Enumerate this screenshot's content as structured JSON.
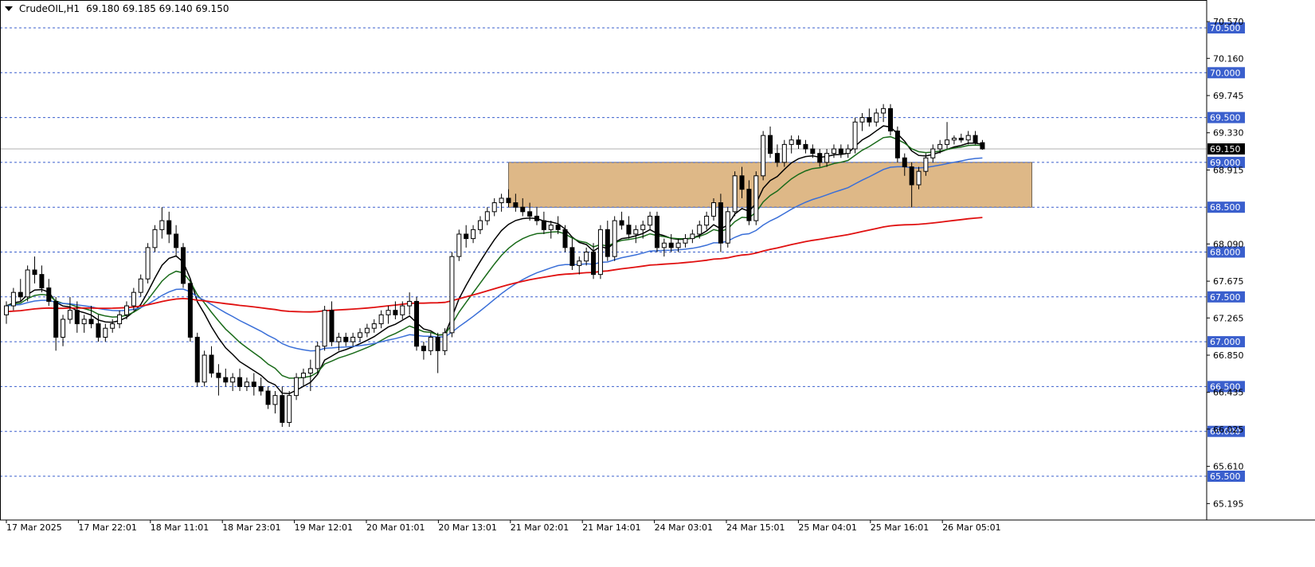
{
  "header": {
    "symbol": "CrudeOIL,H1",
    "ohlc": "69.180 69.185 69.140 69.150"
  },
  "colors": {
    "candle_up_fill": "#ffffff",
    "candle_down_fill": "#000000",
    "candle_outline": "#000000",
    "level_line": "#3a5fcd",
    "level_label_bg": "#3a5fcd",
    "zone_fill": "#deb887",
    "ma_fast": "#000000",
    "ma_mid": "#1a6b1a",
    "ma_slow": "#3a6fd8",
    "ma_long": "#e01010",
    "current_price_bg": "#000000"
  },
  "chart_data": {
    "type": "candlestick",
    "timeframe": "H1",
    "ylim": [
      65.0,
      70.65
    ],
    "price_ticks": [
      "70.570",
      "70.160",
      "69.745",
      "69.330",
      "68.915",
      "68.090",
      "67.675",
      "67.265",
      "66.850",
      "66.435",
      "66.025",
      "65.610",
      "65.195"
    ],
    "levels": [
      "70.500",
      "70.000",
      "69.500",
      "69.000",
      "68.500",
      "68.000",
      "67.500",
      "67.000",
      "66.500",
      "66.000",
      "65.500"
    ],
    "current_price": "69.150",
    "time_labels": [
      "17 Mar 2025",
      "17 Mar 22:01",
      "18 Mar 11:01",
      "18 Mar 23:01",
      "19 Mar 12:01",
      "20 Mar 01:01",
      "20 Mar 13:01",
      "21 Mar 02:01",
      "21 Mar 14:01",
      "24 Mar 03:01",
      "24 Mar 15:01",
      "25 Mar 04:01",
      "25 Mar 16:01",
      "26 Mar 05:01"
    ],
    "zone": {
      "low": 68.5,
      "high": 69.0,
      "start_bar": 71,
      "end_bar": 145
    },
    "candles": [
      [
        67.3,
        67.45,
        67.2,
        67.4
      ],
      [
        67.4,
        67.6,
        67.35,
        67.55
      ],
      [
        67.55,
        67.7,
        67.45,
        67.5
      ],
      [
        67.5,
        67.85,
        67.45,
        67.8
      ],
      [
        67.8,
        67.95,
        67.65,
        67.75
      ],
      [
        67.75,
        67.85,
        67.55,
        67.6
      ],
      [
        67.6,
        67.7,
        67.4,
        67.45
      ],
      [
        67.45,
        67.5,
        66.9,
        67.05
      ],
      [
        67.05,
        67.3,
        66.95,
        67.25
      ],
      [
        67.25,
        67.5,
        67.2,
        67.35
      ],
      [
        67.35,
        67.45,
        67.1,
        67.2
      ],
      [
        67.2,
        67.3,
        67.1,
        67.25
      ],
      [
        67.25,
        67.4,
        67.15,
        67.2
      ],
      [
        67.2,
        67.3,
        67.0,
        67.05
      ],
      [
        67.05,
        67.2,
        67.0,
        67.15
      ],
      [
        67.15,
        67.25,
        67.1,
        67.2
      ],
      [
        67.2,
        67.35,
        67.15,
        67.3
      ],
      [
        67.3,
        67.45,
        67.25,
        67.4
      ],
      [
        67.4,
        67.6,
        67.35,
        67.55
      ],
      [
        67.55,
        67.75,
        67.5,
        67.7
      ],
      [
        67.7,
        68.1,
        67.65,
        68.05
      ],
      [
        68.05,
        68.3,
        68.0,
        68.25
      ],
      [
        68.25,
        68.5,
        68.15,
        68.35
      ],
      [
        68.35,
        68.45,
        68.1,
        68.2
      ],
      [
        68.2,
        68.3,
        67.95,
        68.05
      ],
      [
        68.05,
        68.1,
        67.6,
        67.65
      ],
      [
        67.65,
        67.7,
        67.0,
        67.05
      ],
      [
        67.05,
        67.1,
        66.5,
        66.55
      ],
      [
        66.55,
        66.9,
        66.5,
        66.85
      ],
      [
        66.85,
        66.95,
        66.6,
        66.65
      ],
      [
        66.65,
        66.75,
        66.4,
        66.6
      ],
      [
        66.6,
        66.7,
        66.5,
        66.55
      ],
      [
        66.55,
        66.65,
        66.45,
        66.6
      ],
      [
        66.6,
        66.7,
        66.45,
        66.5
      ],
      [
        66.5,
        66.6,
        66.45,
        66.55
      ],
      [
        66.55,
        66.65,
        66.4,
        66.5
      ],
      [
        66.5,
        66.6,
        66.4,
        66.45
      ],
      [
        66.45,
        66.5,
        66.25,
        66.3
      ],
      [
        66.3,
        66.45,
        66.2,
        66.4
      ],
      [
        66.4,
        66.5,
        66.05,
        66.1
      ],
      [
        66.1,
        66.45,
        66.05,
        66.4
      ],
      [
        66.4,
        66.65,
        66.35,
        66.6
      ],
      [
        66.6,
        66.7,
        66.5,
        66.65
      ],
      [
        66.65,
        66.8,
        66.45,
        66.7
      ],
      [
        66.7,
        67.0,
        66.65,
        66.95
      ],
      [
        66.95,
        67.4,
        66.9,
        67.35
      ],
      [
        67.35,
        67.45,
        66.95,
        67.0
      ],
      [
        67.0,
        67.1,
        66.9,
        67.05
      ],
      [
        67.05,
        67.1,
        66.95,
        67.0
      ],
      [
        67.0,
        67.1,
        66.95,
        67.05
      ],
      [
        67.05,
        67.15,
        67.0,
        67.1
      ],
      [
        67.1,
        67.2,
        67.05,
        67.15
      ],
      [
        67.15,
        67.25,
        67.1,
        67.2
      ],
      [
        67.2,
        67.35,
        67.15,
        67.3
      ],
      [
        67.3,
        67.4,
        67.2,
        67.35
      ],
      [
        67.35,
        67.45,
        67.25,
        67.3
      ],
      [
        67.3,
        67.45,
        67.25,
        67.4
      ],
      [
        67.4,
        67.55,
        67.3,
        67.45
      ],
      [
        67.45,
        67.5,
        66.9,
        66.95
      ],
      [
        66.95,
        67.0,
        66.8,
        66.9
      ],
      [
        66.9,
        67.1,
        66.85,
        67.05
      ],
      [
        67.05,
        67.1,
        66.65,
        66.9
      ],
      [
        66.9,
        67.15,
        66.85,
        67.1
      ],
      [
        67.1,
        68.0,
        67.05,
        67.95
      ],
      [
        67.95,
        68.25,
        67.9,
        68.2
      ],
      [
        68.2,
        68.3,
        68.05,
        68.15
      ],
      [
        68.15,
        68.3,
        68.1,
        68.25
      ],
      [
        68.25,
        68.4,
        68.2,
        68.35
      ],
      [
        68.35,
        68.5,
        68.3,
        68.45
      ],
      [
        68.45,
        68.6,
        68.4,
        68.55
      ],
      [
        68.55,
        68.65,
        68.45,
        68.6
      ],
      [
        68.6,
        68.7,
        68.5,
        68.55
      ],
      [
        68.55,
        68.65,
        68.45,
        68.5
      ],
      [
        68.5,
        68.6,
        68.4,
        68.45
      ],
      [
        68.45,
        68.55,
        68.35,
        68.4
      ],
      [
        68.4,
        68.5,
        68.3,
        68.35
      ],
      [
        68.35,
        68.45,
        68.2,
        68.25
      ],
      [
        68.25,
        68.35,
        68.15,
        68.3
      ],
      [
        68.3,
        68.4,
        68.2,
        68.25
      ],
      [
        68.25,
        68.3,
        68.0,
        68.05
      ],
      [
        68.05,
        68.15,
        67.8,
        67.85
      ],
      [
        67.85,
        67.95,
        67.75,
        67.9
      ],
      [
        67.9,
        68.05,
        67.85,
        68.0
      ],
      [
        68.0,
        68.1,
        67.7,
        67.75
      ],
      [
        67.75,
        68.3,
        67.7,
        68.25
      ],
      [
        68.25,
        68.35,
        67.9,
        67.95
      ],
      [
        67.95,
        68.4,
        67.9,
        68.35
      ],
      [
        68.35,
        68.45,
        68.25,
        68.3
      ],
      [
        68.3,
        68.4,
        68.15,
        68.2
      ],
      [
        68.2,
        68.3,
        68.1,
        68.25
      ],
      [
        68.25,
        68.35,
        68.15,
        68.3
      ],
      [
        68.3,
        68.45,
        68.25,
        68.4
      ],
      [
        68.4,
        68.45,
        68.0,
        68.05
      ],
      [
        68.05,
        68.15,
        67.95,
        68.1
      ],
      [
        68.1,
        68.2,
        68.0,
        68.05
      ],
      [
        68.05,
        68.15,
        68.0,
        68.1
      ],
      [
        68.1,
        68.2,
        68.05,
        68.15
      ],
      [
        68.15,
        68.25,
        68.1,
        68.2
      ],
      [
        68.2,
        68.35,
        68.15,
        68.3
      ],
      [
        68.3,
        68.45,
        68.25,
        68.4
      ],
      [
        68.4,
        68.6,
        68.35,
        68.55
      ],
      [
        68.55,
        68.65,
        68.0,
        68.1
      ],
      [
        68.1,
        68.5,
        68.05,
        68.45
      ],
      [
        68.45,
        68.9,
        68.4,
        68.85
      ],
      [
        68.85,
        68.95,
        68.6,
        68.7
      ],
      [
        68.7,
        68.8,
        68.3,
        68.35
      ],
      [
        68.35,
        68.9,
        68.3,
        68.85
      ],
      [
        68.85,
        69.35,
        68.8,
        69.3
      ],
      [
        69.3,
        69.4,
        69.05,
        69.1
      ],
      [
        69.1,
        69.2,
        68.95,
        69.0
      ],
      [
        69.0,
        69.25,
        68.95,
        69.2
      ],
      [
        69.2,
        69.3,
        69.1,
        69.25
      ],
      [
        69.25,
        69.3,
        69.15,
        69.2
      ],
      [
        69.2,
        69.25,
        69.1,
        69.15
      ],
      [
        69.15,
        69.2,
        69.05,
        69.1
      ],
      [
        69.1,
        69.15,
        68.95,
        69.0
      ],
      [
        69.0,
        69.15,
        68.95,
        69.1
      ],
      [
        69.1,
        69.2,
        69.05,
        69.15
      ],
      [
        69.15,
        69.2,
        69.05,
        69.1
      ],
      [
        69.1,
        69.2,
        69.05,
        69.15
      ],
      [
        69.15,
        69.5,
        69.1,
        69.45
      ],
      [
        69.45,
        69.55,
        69.35,
        69.5
      ],
      [
        69.5,
        69.6,
        69.4,
        69.45
      ],
      [
        69.45,
        69.6,
        69.4,
        69.55
      ],
      [
        69.55,
        69.65,
        69.45,
        69.6
      ],
      [
        69.6,
        69.65,
        69.3,
        69.35
      ],
      [
        69.35,
        69.4,
        69.0,
        69.05
      ],
      [
        69.05,
        69.1,
        68.85,
        68.95
      ],
      [
        68.95,
        69.0,
        68.5,
        68.75
      ],
      [
        68.75,
        68.95,
        68.7,
        68.9
      ],
      [
        68.9,
        69.1,
        68.85,
        69.05
      ],
      [
        69.05,
        69.2,
        69.0,
        69.15
      ],
      [
        69.15,
        69.25,
        69.1,
        69.2
      ],
      [
        69.2,
        69.45,
        69.15,
        69.25
      ],
      [
        69.25,
        69.3,
        69.2,
        69.27
      ],
      [
        69.27,
        69.32,
        69.22,
        69.25
      ],
      [
        69.25,
        69.35,
        69.2,
        69.3
      ],
      [
        69.3,
        69.35,
        69.2,
        69.22
      ],
      [
        69.22,
        69.25,
        69.14,
        69.15
      ]
    ],
    "indicators": [
      {
        "name": "ma_fast",
        "period": 8,
        "color": "#000000"
      },
      {
        "name": "ma_mid",
        "period": 14,
        "color": "#1a6b1a"
      },
      {
        "name": "ma_slow",
        "period": 34,
        "color": "#3a6fd8"
      },
      {
        "name": "ma_long",
        "period": 200,
        "color": "#e01010"
      }
    ],
    "grid": false
  }
}
